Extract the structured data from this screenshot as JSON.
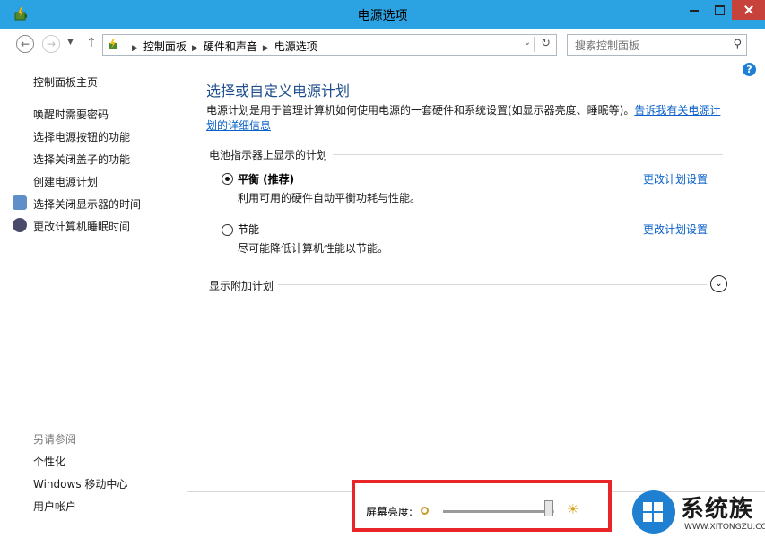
{
  "window": {
    "title": "电源选项"
  },
  "address": {
    "crumbs": [
      "控制面板",
      "硬件和声音",
      "电源选项"
    ]
  },
  "search": {
    "placeholder": "搜索控制面板"
  },
  "sidebar": {
    "home": "控制面板主页",
    "links": [
      "唤醒时需要密码",
      "选择电源按钮的功能",
      "选择关闭盖子的功能",
      "创建电源计划",
      "选择关闭显示器的时间",
      "更改计算机睡眠时间"
    ],
    "see_also": "另请参阅",
    "see_also_links": [
      "个性化",
      "Windows 移动中心",
      "用户帐户"
    ]
  },
  "main": {
    "heading": "选择或自定义电源计划",
    "description": "电源计划是用于管理计算机如何使用电源的一套硬件和系统设置(如显示器亮度、睡眠等)。",
    "learn_more": "告诉我有关电源计划的详细信息",
    "group_label": "电池指示器上显示的计划",
    "plans": [
      {
        "name": "平衡 (推荐)",
        "description": "利用可用的硬件自动平衡功耗与性能。",
        "link": "更改计划设置",
        "selected": true
      },
      {
        "name": "节能",
        "description": "尽可能降低计算机性能以节能。",
        "link": "更改计划设置",
        "selected": false
      }
    ],
    "additional_plans": "显示附加计划"
  },
  "brightness": {
    "label": "屏幕亮度:",
    "level": 0.95
  },
  "watermark": {
    "text": "系统族",
    "url": "WWW.XITONGZU.COM"
  },
  "colors": {
    "titlebar": "#2ba3e2",
    "link": "#0a61c9",
    "heading": "#1e4e8c",
    "highlight_border": "#e8262a"
  }
}
